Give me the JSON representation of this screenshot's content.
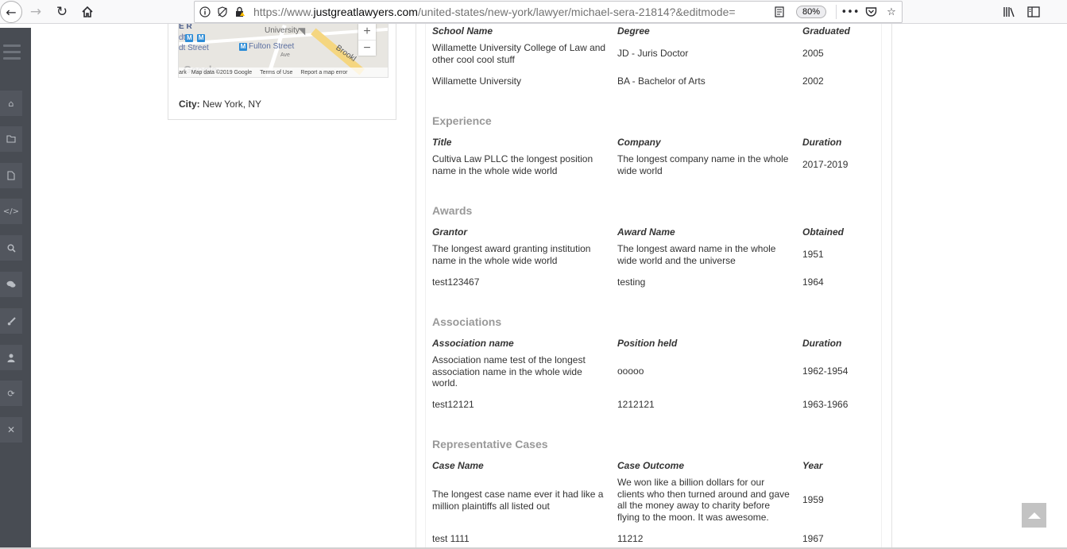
{
  "browser": {
    "url_prefix": "https://www.",
    "url_host": "justgreatlawyers.com",
    "url_path": "/united-states/new-york/lawyer/michael-sera-21814?&editmode=",
    "zoom": "80%",
    "icons": [
      "back-arrow-icon",
      "forward-arrow-icon",
      "reload-icon",
      "home-icon",
      "info-icon",
      "tracking-protection-icon",
      "insecure-lock-icon",
      "reader-view-icon",
      "page-actions-icon",
      "pocket-icon",
      "bookmark-star-icon",
      "library-icon",
      "sidebar-toggle-icon"
    ]
  },
  "sidebar": {
    "icons": [
      "menu-icon",
      "home-icon",
      "folder-icon",
      "file-icon",
      "code-icon",
      "search-icon",
      "comments-icon",
      "brush-icon",
      "user-icon",
      "refresh-icon",
      "close-icon"
    ]
  },
  "map": {
    "labels": {
      "university": "University",
      "fulton": "Fulton Street",
      "street": "dt Street",
      "brooklyn": "Brookl",
      "er": "E R",
      "ave": "Ave"
    },
    "zoom_in": "+",
    "zoom_out": "−",
    "google": "Google",
    "footer_prefix": "ark",
    "map_data": "Map data ©2019 Google",
    "terms": "Terms of Use",
    "report": "Report a map error"
  },
  "city": {
    "label": "City:",
    "value": "New York, NY"
  },
  "education": {
    "headers": [
      "School Name",
      "Degree",
      "Graduated"
    ],
    "rows": [
      [
        "Willamette University College of Law and other cool cool stuff",
        "JD - Juris Doctor",
        "2005"
      ],
      [
        "Willamette University",
        "BA - Bachelor of Arts",
        "2002"
      ]
    ]
  },
  "experience": {
    "title": "Experience",
    "headers": [
      "Title",
      "Company",
      "Duration"
    ],
    "rows": [
      [
        "Cultiva Law PLLC the longest position name in the whole wide world",
        "The longest company name in the whole wide world",
        "2017-2019"
      ]
    ]
  },
  "awards": {
    "title": "Awards",
    "headers": [
      "Grantor",
      "Award Name",
      "Obtained"
    ],
    "rows": [
      [
        "The longest award granting institution name in the whole wide world",
        "The longest award name in the whole wide world and the universe",
        "1951"
      ],
      [
        "test123467",
        "testing",
        "1964"
      ]
    ]
  },
  "associations": {
    "title": "Associations",
    "headers": [
      "Association name",
      "Position held",
      "Duration"
    ],
    "rows": [
      [
        "Association name test of the longest association name in the whole wide world.",
        "ooooo",
        "1962-1954"
      ],
      [
        "test12121",
        "1212121",
        "1963-1966"
      ]
    ]
  },
  "cases": {
    "title": "Representative Cases",
    "headers": [
      "Case Name",
      "Case Outcome",
      "Year"
    ],
    "rows": [
      [
        "The longest case name ever it had like a million plaintiffs all listed out",
        "We won like a billion dollars for our clients who then turned around and gave all the money away to charity before flying to the moon. It was awesome.",
        "1959"
      ],
      [
        "test 1111",
        "11212",
        "1967"
      ]
    ]
  },
  "colors": {
    "sidebar_bg": "#484c53",
    "section_title": "#999999",
    "scroll_button": "#c3c3c3"
  }
}
